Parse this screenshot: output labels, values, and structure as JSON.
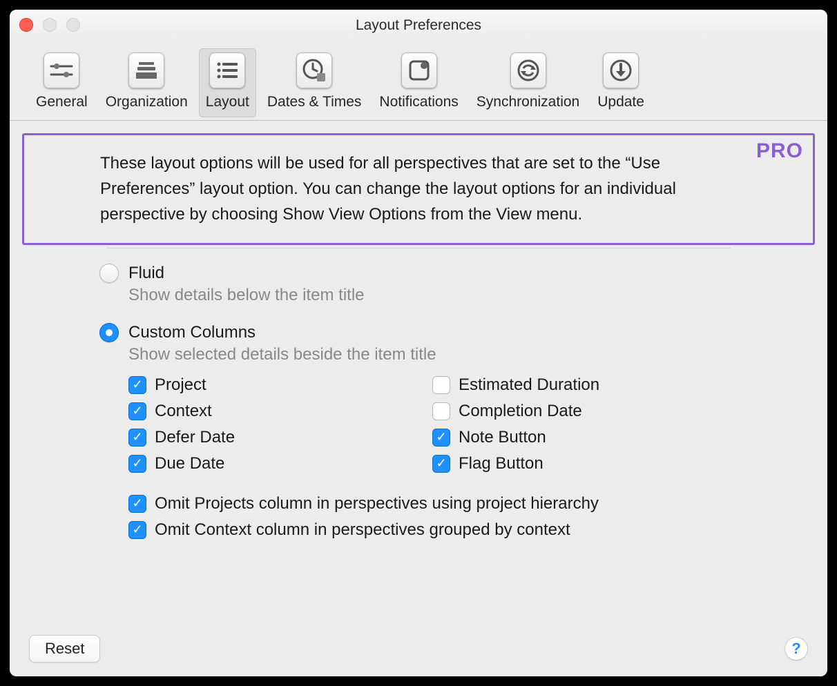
{
  "window": {
    "title": "Layout Preferences"
  },
  "toolbar": {
    "tabs": [
      {
        "id": "general",
        "label": "General",
        "selected": false
      },
      {
        "id": "organization",
        "label": "Organization",
        "selected": false
      },
      {
        "id": "layout",
        "label": "Layout",
        "selected": true
      },
      {
        "id": "dates-times",
        "label": "Dates & Times",
        "selected": false
      },
      {
        "id": "notifications",
        "label": "Notifications",
        "selected": false
      },
      {
        "id": "synchronization",
        "label": "Synchronization",
        "selected": false
      },
      {
        "id": "update",
        "label": "Update",
        "selected": false
      }
    ]
  },
  "callout": {
    "badge": "PRO",
    "text": "These layout options will be used for all perspectives that are set to the “Use Preferences” layout option. You can change the layout options for an individual perspective by choosing Show View Options from the View menu."
  },
  "layout_modes": {
    "fluid": {
      "label": "Fluid",
      "desc": "Show details below the item title",
      "selected": false
    },
    "custom": {
      "label": "Custom Columns",
      "desc": "Show selected details beside the item title",
      "selected": true
    }
  },
  "columns_left": [
    {
      "id": "project",
      "label": "Project",
      "checked": true
    },
    {
      "id": "context",
      "label": "Context",
      "checked": true
    },
    {
      "id": "defer",
      "label": "Defer Date",
      "checked": true
    },
    {
      "id": "due",
      "label": "Due Date",
      "checked": true
    }
  ],
  "columns_right": [
    {
      "id": "estimated",
      "label": "Estimated Duration",
      "checked": false
    },
    {
      "id": "completion",
      "label": "Completion Date",
      "checked": false
    },
    {
      "id": "notebtn",
      "label": "Note Button",
      "checked": true
    },
    {
      "id": "flagbtn",
      "label": "Flag Button",
      "checked": true
    }
  ],
  "omits": [
    {
      "id": "omit-projects",
      "label": "Omit Projects column in perspectives using project hierarchy",
      "checked": true
    },
    {
      "id": "omit-context",
      "label": "Omit Context column in perspectives grouped by context",
      "checked": true
    }
  ],
  "footer": {
    "reset": "Reset",
    "help": "?"
  }
}
